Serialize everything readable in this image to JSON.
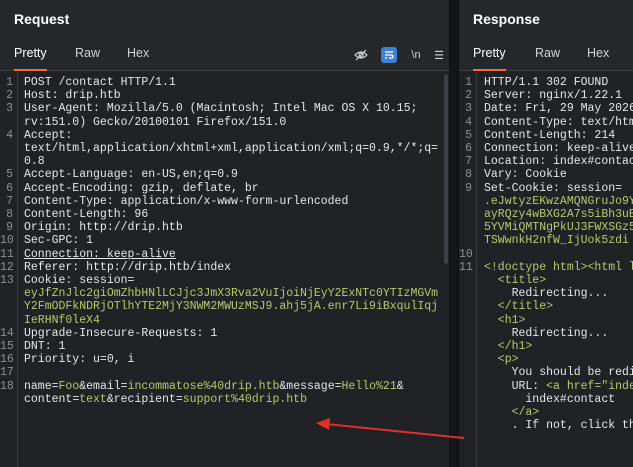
{
  "request": {
    "title": "Request",
    "tabs": [
      "Pretty",
      "Raw",
      "Hex"
    ],
    "tools": {
      "newline": "\\n",
      "menu": "☰"
    },
    "lines": [
      {
        "n": "1",
        "parts": [
          {
            "t": "POST /contact HTTP/1.1",
            "c": "k"
          }
        ]
      },
      {
        "n": "2",
        "parts": [
          {
            "t": "Host: ",
            "c": "k"
          },
          {
            "t": "drip.htb",
            "c": "v"
          }
        ]
      },
      {
        "n": "3",
        "parts": [
          {
            "t": "User-Agent: ",
            "c": "k"
          },
          {
            "t": "Mozilla/5.0 (Macintosh; Intel Mac OS X 10.15;",
            "c": "v"
          }
        ]
      },
      {
        "n": "",
        "parts": [
          {
            "t": "rv:151.0) Gecko/20100101 Firefox/151.0",
            "c": "v"
          }
        ]
      },
      {
        "n": "4",
        "parts": [
          {
            "t": "Accept:",
            "c": "k"
          }
        ]
      },
      {
        "n": "",
        "parts": [
          {
            "t": "text/html,application/xhtml+xml,application/xml;q=0.9,*/*;q=",
            "c": "v"
          }
        ]
      },
      {
        "n": "",
        "parts": [
          {
            "t": "0.8",
            "c": "v"
          }
        ]
      },
      {
        "n": "5",
        "parts": [
          {
            "t": "Accept-Language: ",
            "c": "k"
          },
          {
            "t": "en-US,en;q=0.9",
            "c": "v"
          }
        ]
      },
      {
        "n": "6",
        "parts": [
          {
            "t": "Accept-Encoding: ",
            "c": "k"
          },
          {
            "t": "gzip, deflate, br",
            "c": "v"
          }
        ]
      },
      {
        "n": "7",
        "parts": [
          {
            "t": "Content-Type: ",
            "c": "k"
          },
          {
            "t": "application/x-www-form-urlencoded",
            "c": "v"
          }
        ]
      },
      {
        "n": "8",
        "parts": [
          {
            "t": "Content-Length: ",
            "c": "k"
          },
          {
            "t": "96",
            "c": "v"
          }
        ]
      },
      {
        "n": "9",
        "parts": [
          {
            "t": "Origin: ",
            "c": "k"
          },
          {
            "t": "http://drip.htb",
            "c": "v"
          }
        ]
      },
      {
        "n": "10",
        "parts": [
          {
            "t": "Sec-GPC: ",
            "c": "k"
          },
          {
            "t": "1",
            "c": "v"
          }
        ]
      },
      {
        "n": "11",
        "parts": [
          {
            "t": "Connection: keep-alive",
            "c": "k u"
          }
        ]
      },
      {
        "n": "12",
        "parts": [
          {
            "t": "Referer: ",
            "c": "k"
          },
          {
            "t": "http://drip.htb/index",
            "c": "v"
          }
        ]
      },
      {
        "n": "13",
        "parts": [
          {
            "t": "Cookie: ",
            "c": "k"
          },
          {
            "t": "session=",
            "c": "v"
          }
        ]
      },
      {
        "n": "",
        "parts": [
          {
            "t": "eyJfZnJlc2giOmZhbHNlLCJjc3JmX3Rva2VuIjoiNjEyY2ExNTc0YTIzMGVm",
            "c": "g"
          }
        ]
      },
      {
        "n": "",
        "parts": [
          {
            "t": "Y2FmODFkNDRjOTlhYTE2MjY3NWM2MWUzMSJ9.ahj5jA.enr7Li9iBxqulIqj",
            "c": "g"
          }
        ]
      },
      {
        "n": "",
        "parts": [
          {
            "t": "IeRHNf0leX4",
            "c": "g"
          }
        ]
      },
      {
        "n": "14",
        "parts": [
          {
            "t": "Upgrade-Insecure-Requests: ",
            "c": "k"
          },
          {
            "t": "1",
            "c": "v"
          }
        ]
      },
      {
        "n": "15",
        "parts": [
          {
            "t": "DNT: ",
            "c": "k"
          },
          {
            "t": "1",
            "c": "v"
          }
        ]
      },
      {
        "n": "16",
        "parts": [
          {
            "t": "Priority: ",
            "c": "k"
          },
          {
            "t": "u=0, i",
            "c": "v"
          }
        ]
      },
      {
        "n": "17",
        "parts": []
      },
      {
        "n": "18",
        "parts": [
          {
            "t": "name",
            "c": "k"
          },
          {
            "t": "=",
            "c": "v"
          },
          {
            "t": "Foo",
            "c": "g"
          },
          {
            "t": "&",
            "c": "v"
          },
          {
            "t": "email",
            "c": "k"
          },
          {
            "t": "=",
            "c": "v"
          },
          {
            "t": "incommatose%40drip.htb",
            "c": "g"
          },
          {
            "t": "&",
            "c": "v"
          },
          {
            "t": "message",
            "c": "k"
          },
          {
            "t": "=",
            "c": "v"
          },
          {
            "t": "Hello%21",
            "c": "g"
          },
          {
            "t": "&",
            "c": "v"
          }
        ]
      },
      {
        "n": "",
        "parts": [
          {
            "t": "content",
            "c": "k"
          },
          {
            "t": "=",
            "c": "v"
          },
          {
            "t": "text",
            "c": "g"
          },
          {
            "t": "&",
            "c": "v"
          },
          {
            "t": "recipient",
            "c": "k"
          },
          {
            "t": "=",
            "c": "v"
          },
          {
            "t": "support%40drip.htb",
            "c": "g"
          }
        ]
      }
    ]
  },
  "response": {
    "title": "Response",
    "tabs": [
      "Pretty",
      "Raw",
      "Hex"
    ],
    "lines": [
      {
        "n": "1",
        "parts": [
          {
            "t": "HTTP/1.1 302 FOUND",
            "c": "k"
          }
        ]
      },
      {
        "n": "2",
        "parts": [
          {
            "t": "Server: ",
            "c": "k"
          },
          {
            "t": "nginx/1.22.1",
            "c": "v"
          }
        ]
      },
      {
        "n": "3",
        "parts": [
          {
            "t": "Date: ",
            "c": "k"
          },
          {
            "t": "Fri, 29 May 2026",
            "c": "v"
          }
        ]
      },
      {
        "n": "4",
        "parts": [
          {
            "t": "Content-Type: ",
            "c": "k"
          },
          {
            "t": "text/htm",
            "c": "v"
          }
        ]
      },
      {
        "n": "5",
        "parts": [
          {
            "t": "Content-Length: ",
            "c": "k"
          },
          {
            "t": "214",
            "c": "v"
          }
        ]
      },
      {
        "n": "6",
        "parts": [
          {
            "t": "Connection: ",
            "c": "k"
          },
          {
            "t": "keep-alive",
            "c": "v"
          }
        ]
      },
      {
        "n": "7",
        "parts": [
          {
            "t": "Location: ",
            "c": "k"
          },
          {
            "t": "index#contac",
            "c": "v"
          }
        ]
      },
      {
        "n": "8",
        "parts": [
          {
            "t": "Vary: ",
            "c": "k"
          },
          {
            "t": "Cookie",
            "c": "v"
          }
        ]
      },
      {
        "n": "9",
        "parts": [
          {
            "t": "Set-Cookie: ",
            "c": "k"
          },
          {
            "t": "session=",
            "c": "v"
          }
        ]
      },
      {
        "n": "",
        "parts": [
          {
            "t": ".eJwtyzEKwzAMQNGruJo9Y",
            "c": "g"
          }
        ]
      },
      {
        "n": "",
        "parts": [
          {
            "t": "ayRQzy4wBXG2A7s5iBh3uB",
            "c": "g"
          }
        ]
      },
      {
        "n": "",
        "parts": [
          {
            "t": "5YVMiQMTNgPkUJ3FWXSGz5",
            "c": "g"
          }
        ]
      },
      {
        "n": "",
        "parts": [
          {
            "t": "TSWwnkH2nfW_IjUok5zdi",
            "c": "g"
          }
        ]
      },
      {
        "n": "10",
        "parts": []
      },
      {
        "n": "11",
        "parts": [
          {
            "t": "<!doctype html><html l",
            "c": "tag"
          }
        ]
      },
      {
        "n": "",
        "parts": [
          {
            "t": "  <title>",
            "c": "tag"
          }
        ]
      },
      {
        "n": "",
        "parts": [
          {
            "t": "    Redirecting...",
            "c": "v"
          }
        ]
      },
      {
        "n": "",
        "parts": [
          {
            "t": "  </title>",
            "c": "tag"
          }
        ]
      },
      {
        "n": "",
        "parts": [
          {
            "t": "  <h1>",
            "c": "tag"
          }
        ]
      },
      {
        "n": "",
        "parts": [
          {
            "t": "    Redirecting...",
            "c": "v"
          }
        ]
      },
      {
        "n": "",
        "parts": [
          {
            "t": "  </h1>",
            "c": "tag"
          }
        ]
      },
      {
        "n": "",
        "parts": [
          {
            "t": "  <p>",
            "c": "tag"
          }
        ]
      },
      {
        "n": "",
        "parts": [
          {
            "t": "    You should be redi",
            "c": "v"
          }
        ]
      },
      {
        "n": "",
        "parts": [
          {
            "t": "    URL: ",
            "c": "v"
          },
          {
            "t": "<a href=\"inde",
            "c": "tag"
          }
        ]
      },
      {
        "n": "",
        "parts": [
          {
            "t": "      index#contact",
            "c": "v"
          }
        ]
      },
      {
        "n": "",
        "parts": [
          {
            "t": "    </a>",
            "c": "tag"
          }
        ]
      },
      {
        "n": "",
        "parts": [
          {
            "t": "    . If not, click th",
            "c": "v"
          }
        ]
      }
    ]
  }
}
